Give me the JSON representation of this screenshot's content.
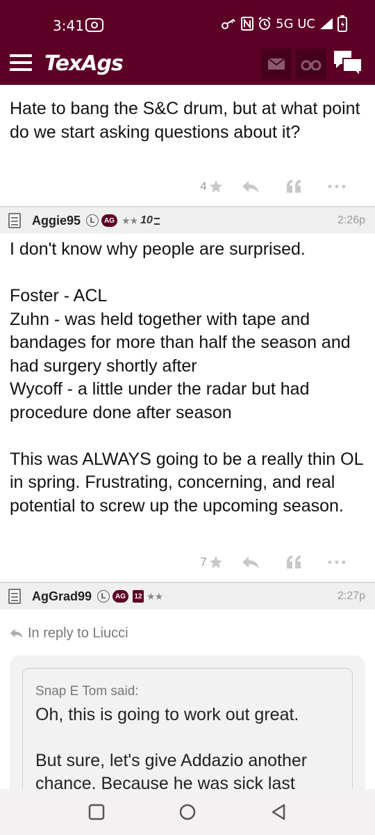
{
  "status_bar": {
    "time": "3:41",
    "network": "5G UC"
  },
  "app": {
    "logo_text": "TexAgs",
    "brand_color": "#5c0025"
  },
  "posts": [
    {
      "body": "Hate to bang the S&C drum, but at what point do we start asking questions about it?",
      "rating": "4"
    },
    {
      "username": "Aggie95",
      "badge_l": "L",
      "badge_ag": "AG",
      "stars": "★★",
      "badge_extra": "10",
      "time": "2:26p",
      "body": "I don't know why people are surprised.\n\nFoster - ACL\nZuhn - was held together with tape and bandages for more than half the season and had surgery shortly after\nWycoff - a little under the radar but had procedure done after season\n\nThis was ALWAYS going to be a really thin OL in spring. Frustrating, concerning, and real potential to screw up the upcoming season.",
      "rating": "7"
    },
    {
      "username": "AgGrad99",
      "badge_l": "L",
      "badge_ag": "AG",
      "badge_12": "12",
      "stars": "★★",
      "time": "2:27p",
      "reply_to": "In reply to Liucci",
      "quote_author": "Snap E Tom said:",
      "quote_text": "Oh, this is going to work out great.\n\nBut sure, let's give Addazio another chance. Because he was sick last"
    }
  ]
}
